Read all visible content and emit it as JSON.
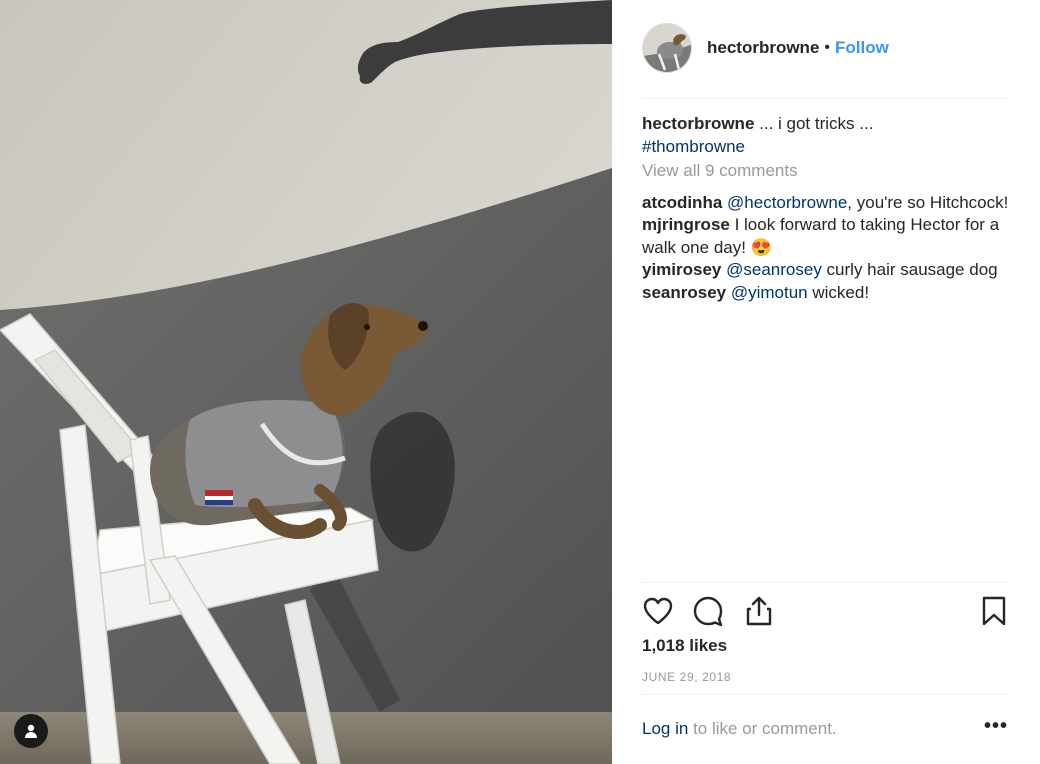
{
  "post": {
    "username": "hectorbrowne",
    "separator": "•",
    "follow_label": "Follow",
    "caption": {
      "username": "hectorbrowne",
      "text": " ... i got tricks ... ",
      "hashtag": "#thombrowne"
    },
    "view_all_label": "View all 9 comments",
    "comments": [
      {
        "user": "atcodinha",
        "mention": "@hectorbrowne",
        "text": ", you're so Hitchcock!"
      },
      {
        "user": "mjringrose",
        "mention": "",
        "text": " I look forward to taking Hector for a walk one day! 😍"
      },
      {
        "user": "yimirosey",
        "mention": "@seanrosey",
        "text": " curly hair sausage dog"
      },
      {
        "user": "seanrosey",
        "mention": "@yimotun",
        "text": " wicked!"
      }
    ],
    "likes": "1,018 likes",
    "date": "JUNE 29, 2018",
    "login_link": "Log in",
    "login_text": " to like or comment.",
    "more_label": "•••"
  },
  "icons": {
    "like": "heart-icon",
    "comment": "comment-icon",
    "share": "share-icon",
    "save": "bookmark-icon",
    "tag": "user-tag-icon"
  },
  "colors": {
    "follow": "#3897f0",
    "link": "#003569",
    "muted": "#999999",
    "text": "#262626"
  }
}
